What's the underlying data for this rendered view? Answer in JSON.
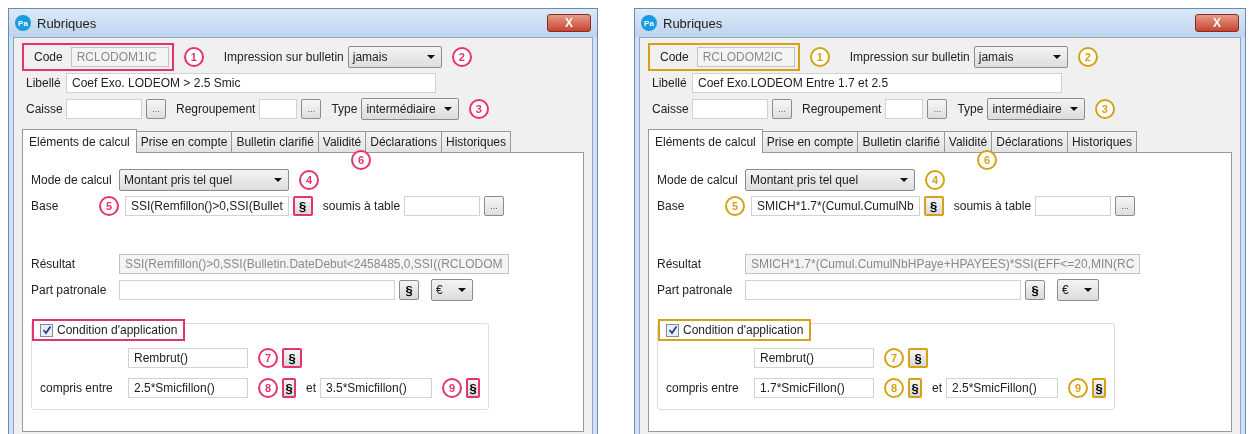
{
  "windows": [
    {
      "title": "Rubriques",
      "app_icon": "Pa",
      "close": "X",
      "color": "#e5336d",
      "code": {
        "label": "Code",
        "value": "RCLODOM1IC",
        "highlighted": true,
        "marker": "1"
      },
      "impression": {
        "label": "Impression sur bulletin",
        "value": "jamais",
        "marker": "2"
      },
      "libelle": {
        "label": "Libellé",
        "value": "Coef Exo. LODEOM > 2.5 Smic"
      },
      "caisse": {
        "label": "Caisse",
        "button": "..."
      },
      "regroupement": {
        "label": "Regroupement",
        "button": "..."
      },
      "type": {
        "label": "Type",
        "value": "intermédiaire",
        "marker": "3"
      },
      "tabs": [
        {
          "label": "Eléments de calcul",
          "selected": true
        },
        {
          "label": "Prise en compte",
          "selected": false
        },
        {
          "label": "Bulletin clarifié",
          "selected": false
        },
        {
          "label": "Validité",
          "selected": false
        },
        {
          "label": "Déclarations",
          "selected": false
        },
        {
          "label": "Historiques",
          "selected": false
        }
      ],
      "tabs_marker": "6",
      "mode_de_calcul": {
        "label": "Mode de calcul",
        "value": "Montant pris tel quel",
        "marker": "4"
      },
      "base": {
        "label": "Base",
        "marker": "5",
        "value": "SSI(Remfillon()>0,SSI(Bullet",
        "formula_button": "§",
        "highlighted": true,
        "table_label": "soumis à table",
        "table_button": "..."
      },
      "resultat": {
        "label": "Résultat",
        "value": "SSI(Remfillon()>0,SSI(Bulletin.DateDebut<2458485,0,SSI((RCLODOM"
      },
      "part_patronale": {
        "label": "Part patronale",
        "formula_button": "§",
        "highlighted": false,
        "currency": "€"
      },
      "condition": {
        "label": "Condition d'application",
        "checked": true,
        "highlighted": true
      },
      "expression": {
        "value": "Rembrut()",
        "marker": "7",
        "formula_button": "§",
        "highlighted": true
      },
      "range": {
        "label": "compris entre",
        "and_label": "et",
        "min": {
          "value": "2.5*Smicfillon()",
          "marker": "8",
          "formula_button": "§",
          "highlighted": true
        },
        "max": {
          "value": "3.5*Smicfillon()",
          "marker": "9",
          "formula_button": "§",
          "highlighted": true
        }
      }
    },
    {
      "title": "Rubriques",
      "app_icon": "Pa",
      "close": "X",
      "color": "#d4a214",
      "code": {
        "label": "Code",
        "value": "RCLODOM2IC",
        "highlighted": true,
        "marker": "1"
      },
      "impression": {
        "label": "Impression sur bulletin",
        "value": "jamais",
        "marker": "2"
      },
      "libelle": {
        "label": "Libellé",
        "value": "Coef Exo.LODEOM Entre 1.7 et 2.5"
      },
      "caisse": {
        "label": "Caisse",
        "button": "..."
      },
      "regroupement": {
        "label": "Regroupement",
        "button": "..."
      },
      "type": {
        "label": "Type",
        "value": "intermédiaire",
        "marker": "3"
      },
      "tabs": [
        {
          "label": "Eléments de calcul",
          "selected": true
        },
        {
          "label": "Prise en compte",
          "selected": false
        },
        {
          "label": "Bulletin clarifié",
          "selected": false
        },
        {
          "label": "Validité",
          "selected": false
        },
        {
          "label": "Déclarations",
          "selected": false
        },
        {
          "label": "Historiques",
          "selected": false
        }
      ],
      "tabs_marker": "6",
      "mode_de_calcul": {
        "label": "Mode de calcul",
        "value": "Montant pris tel quel",
        "marker": "4"
      },
      "base": {
        "label": "Base",
        "marker": "5",
        "value": "SMICH*1.7*(Cumul.CumulNb",
        "formula_button": "§",
        "highlighted": true,
        "table_label": "soumis à table",
        "table_button": "..."
      },
      "resultat": {
        "label": "Résultat",
        "value": "SMICH*1.7*(Cumul.CumulNbHPaye+HPAYEES)*SSI(EFF<=20,MIN(RC"
      },
      "part_patronale": {
        "label": "Part patronale",
        "formula_button": "§",
        "highlighted": false,
        "currency": "€"
      },
      "condition": {
        "label": "Condition d'application",
        "checked": true,
        "highlighted": true
      },
      "expression": {
        "value": "Rembrut()",
        "marker": "7",
        "formula_button": "§",
        "highlighted": true
      },
      "range": {
        "label": "compris entre",
        "and_label": "et",
        "min": {
          "value": "1.7*SmicFillon()",
          "marker": "8",
          "formula_button": "§",
          "highlighted": true
        },
        "max": {
          "value": "2.5*SmicFillon()",
          "marker": "9",
          "formula_button": "§",
          "highlighted": true
        }
      }
    }
  ]
}
